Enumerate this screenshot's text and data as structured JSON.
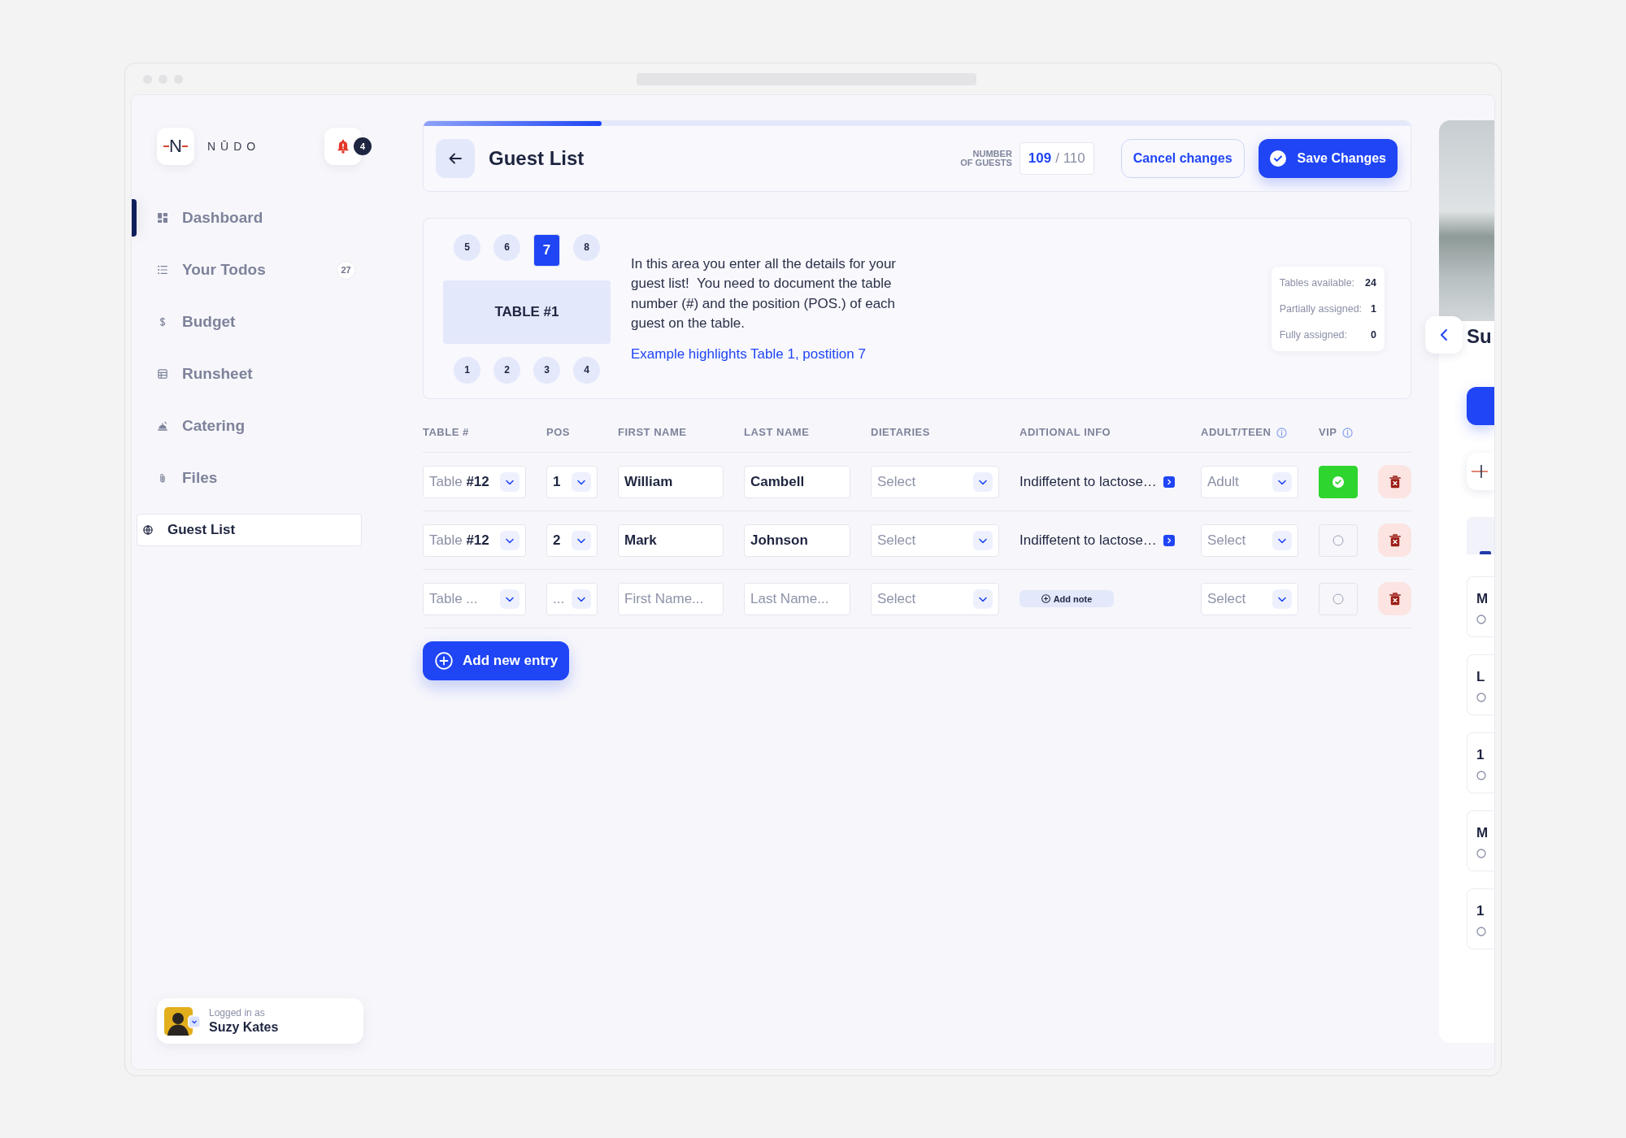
{
  "sidebar": {
    "logo": {
      "mark": "N",
      "wordmark": "NŪDO"
    },
    "notifications": {
      "count": "4"
    },
    "nav": [
      {
        "label": "Dashboard",
        "selected": false,
        "marked": true
      },
      {
        "label": "Your Todos",
        "selected": false,
        "marked": false,
        "badge": "27"
      },
      {
        "label": "Budget",
        "selected": false,
        "marked": false
      },
      {
        "label": "Runsheet",
        "selected": false,
        "marked": false
      },
      {
        "label": "Catering",
        "selected": false,
        "marked": false
      },
      {
        "label": "Files",
        "selected": false,
        "marked": false
      },
      {
        "label": "Guest List",
        "selected": true,
        "marked": false
      }
    ],
    "user": {
      "caption": "Logged in as",
      "name": "Suzy Kates"
    }
  },
  "header": {
    "progress": {
      "level": 0.18
    },
    "title": "Guest List",
    "guest_count": {
      "label": "NUMBER OF GUESTS",
      "count": "109",
      "total": "/ 110"
    },
    "buttons": [
      {
        "label": "Cancel changes",
        "kind": "secondary"
      },
      {
        "label": "Save Changes",
        "kind": "primary"
      }
    ]
  },
  "info_panel": {
    "top_seats": [
      {
        "number": "5",
        "selected": false
      },
      {
        "number": "6",
        "selected": false
      },
      {
        "number": "7",
        "selected": true
      },
      {
        "number": "8",
        "selected": false
      }
    ],
    "table_label": "TABLE #1",
    "bottom_seats": [
      {
        "number": "1",
        "selected": false
      },
      {
        "number": "2",
        "selected": false
      },
      {
        "number": "3",
        "selected": false
      },
      {
        "number": "4",
        "selected": false
      }
    ],
    "description": "In this area you enter all the details for your guest list!  You need to document the table number (#) and the position (POS.) of each guest on the table.",
    "example_link": "Example highlights Table 1, postition 7",
    "stats": [
      {
        "label": "Tables available:",
        "value": "24"
      },
      {
        "label": "Partially assigned:",
        "value": "1"
      },
      {
        "label": "Fully assigned:",
        "value": "0"
      }
    ]
  },
  "table": {
    "columns": [
      {
        "label": "TABLE #",
        "info": false
      },
      {
        "label": "POS",
        "info": false
      },
      {
        "label": "FIRST NAME",
        "info": false
      },
      {
        "label": "LAST NAME",
        "info": false
      },
      {
        "label": "DIETARIES",
        "info": false
      },
      {
        "label": "ADITIONAL INFO",
        "info": false
      },
      {
        "label": "ADULT/TEEN",
        "info": true
      },
      {
        "label": "VIP",
        "info": true
      }
    ],
    "rows": [
      {
        "table": {
          "value": "Table **#12**"
        },
        "pos": {
          "value": "1"
        },
        "first_name": {
          "value": "William"
        },
        "last_name": {
          "value": "Cambell"
        },
        "dietaries": {
          "placeholder": "Select"
        },
        "additional_info": {
          "kind": "note",
          "text": "Indiffetent to lactose…"
        },
        "age_group": {
          "value": "Adult"
        },
        "vip": {
          "checked": true
        }
      },
      {
        "table": {
          "value": "Table **#12**"
        },
        "pos": {
          "value": "2"
        },
        "first_name": {
          "value": "Mark"
        },
        "last_name": {
          "value": "Johnson"
        },
        "dietaries": {
          "placeholder": "Select"
        },
        "additional_info": {
          "kind": "note",
          "text": "Indiffetent to lactose…"
        },
        "age_group": {
          "placeholder": "Select"
        },
        "vip": {
          "checked": false
        }
      },
      {
        "table": {
          "placeholder": "Table ..."
        },
        "pos": {
          "placeholder": "..."
        },
        "first_name": {
          "placeholder": "First Name..."
        },
        "last_name": {
          "placeholder": "Last Name..."
        },
        "dietaries": {
          "placeholder": "Select"
        },
        "additional_info": {
          "kind": "add",
          "label": "Add note"
        },
        "age_group": {
          "placeholder": "Select"
        },
        "vip": {
          "checked": false
        }
      }
    ]
  },
  "add_button": {
    "label": "Add new entry"
  },
  "right_panel": {
    "title": "Su",
    "cards": [
      {
        "title": "M"
      },
      {
        "title": "L"
      },
      {
        "title": "1"
      },
      {
        "title": "M"
      },
      {
        "title": "1"
      }
    ]
  }
}
